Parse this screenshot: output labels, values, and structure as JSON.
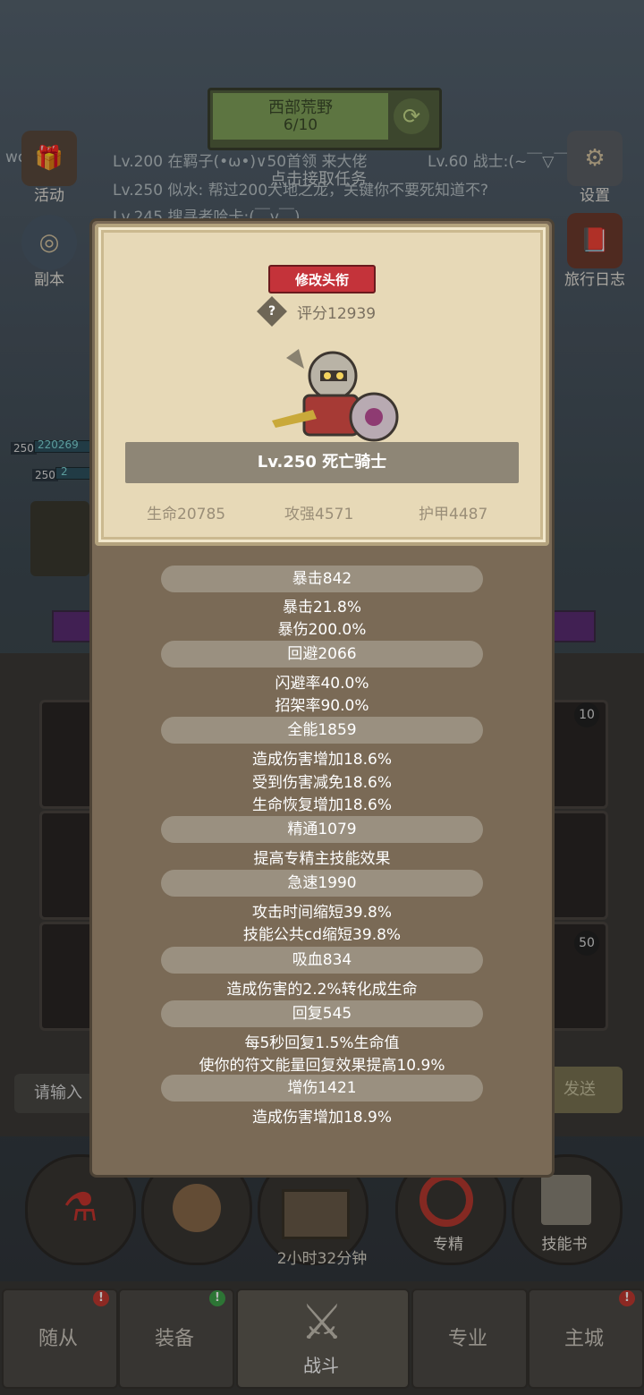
{
  "zone": {
    "title": "西部荒野",
    "progress": "6/10",
    "prompt": "点击接取任务"
  },
  "chat": [
    "Lv.200 在羁子(•ω•)∨50首领 来大佬",
    "Lv.60 战士:(~￣▽￣)~**",
    "Lv.250 似水: 帮过200大地之龙，关键你不要死知道不?",
    "Lv.245 搜寻者哈卡:(￣v￣)"
  ],
  "user_tag": "wowei",
  "side_left": [
    {
      "label": "活动",
      "icon": "gift-icon"
    },
    {
      "label": "副本",
      "icon": "portal-icon"
    }
  ],
  "side_right": [
    {
      "label": "设置",
      "icon": "gear-icon"
    },
    {
      "label": "旅行日志",
      "icon": "book-icon"
    }
  ],
  "party": [
    {
      "level": "250",
      "hp": "220269"
    },
    {
      "level": "250",
      "hp": "2"
    }
  ],
  "slots_right_numbers": [
    "10",
    "50"
  ],
  "chat_input_placeholder": "请输入",
  "send_label": "发送",
  "action_buttons": [
    {
      "label": "",
      "icon": "potion-icon"
    },
    {
      "label": "",
      "icon": "bread-icon"
    },
    {
      "label": "",
      "icon": "chest-icon"
    },
    {
      "label": "专精",
      "icon": "spec-icon"
    },
    {
      "label": "技能书",
      "icon": "skillbook-icon"
    }
  ],
  "timer": "2小时32分钟",
  "tabs": [
    {
      "label": "随从",
      "badge": "!",
      "badge_color": "red"
    },
    {
      "label": "装备",
      "badge": "!",
      "badge_color": "green"
    },
    {
      "label": "战斗",
      "badge": "",
      "badge_color": ""
    },
    {
      "label": "专业",
      "badge": "",
      "badge_color": ""
    },
    {
      "label": "主城",
      "badge": "!",
      "badge_color": "red"
    }
  ],
  "modal": {
    "rename_button": "修改头衔",
    "score": "评分12939",
    "character": "Lv.250 死亡骑士",
    "stats": {
      "hp": "生命20785",
      "attack": "攻强4571",
      "armor": "护甲4487"
    },
    "sections": [
      {
        "title": "暴击842",
        "lines": [
          "暴击21.8%",
          "暴伤200.0%"
        ]
      },
      {
        "title": "回避2066",
        "lines": [
          "闪避率40.0%",
          "招架率90.0%"
        ]
      },
      {
        "title": "全能1859",
        "lines": [
          "造成伤害增加18.6%",
          "受到伤害减免18.6%",
          "生命恢复增加18.6%"
        ]
      },
      {
        "title": "精通1079",
        "lines": [
          "提高专精主技能效果"
        ]
      },
      {
        "title": "急速1990",
        "lines": [
          "攻击时间缩短39.8%",
          "技能公共cd缩短39.8%"
        ]
      },
      {
        "title": "吸血834",
        "lines": [
          "造成伤害的2.2%转化成生命"
        ]
      },
      {
        "title": "回复545",
        "lines": [
          "每5秒回复1.5%生命值",
          "使你的符文能量回复效果提高10.9%"
        ]
      },
      {
        "title": "增伤1421",
        "lines": [
          "造成伤害增加18.9%"
        ]
      }
    ]
  }
}
